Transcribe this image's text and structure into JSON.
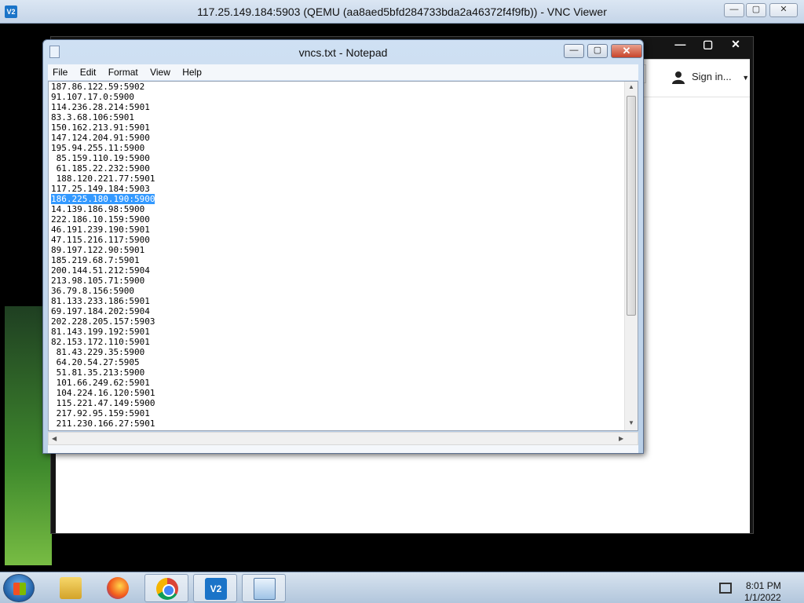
{
  "vnc": {
    "title": "117.25.149.184:5903 (QEMU (aa8aed5bfd284733bda2a46372f4f9fb)) - VNC Viewer",
    "icon": "V2",
    "min": "—",
    "max": "▢",
    "close": "✕"
  },
  "browser": {
    "min": "—",
    "max": "▢",
    "close": "✕",
    "sign_in": "Sign in...",
    "caret": "▼"
  },
  "notepad": {
    "title": "vncs.txt - Notepad",
    "min": "—",
    "max": "▢",
    "close": "✕",
    "menu": [
      "File",
      "Edit",
      "Format",
      "View",
      "Help"
    ],
    "selected_index": 11,
    "lines": [
      "187.86.122.59:5902",
      "91.107.17.0:5900",
      "114.236.28.214:5901",
      "83.3.68.106:5901",
      "150.162.213.91:5901",
      "147.124.204.91:5900",
      "195.94.255.11:5900",
      " 85.159.110.19:5900",
      " 61.185.22.232:5900",
      " 188.120.221.77:5901",
      "117.25.149.184:5903",
      "186.225.180.190:5900",
      "14.139.186.98:5900",
      "222.186.10.159:5900",
      "46.191.239.190:5901",
      "47.115.216.117:5900",
      "89.197.122.90:5901",
      "185.219.68.7:5901",
      "200.144.51.212:5904",
      "213.98.105.71:5900",
      "36.79.8.156:5900",
      "81.133.233.186:5901",
      "69.197.184.202:5904",
      "202.228.205.157:5903",
      "81.143.199.192:5901",
      "82.153.172.110:5901",
      " 81.43.229.35:5900",
      " 64.20.54.27:5905",
      " 51.81.35.213:5900",
      " 101.66.249.62:5901",
      " 104.224.16.120:5901",
      " 115.221.47.149:5900",
      " 217.92.95.159:5901",
      " 211.230.166.27:5901"
    ]
  },
  "taskbar": {
    "vnc_label": "V2",
    "time": "8:01 PM",
    "date": "1/1/2022"
  }
}
